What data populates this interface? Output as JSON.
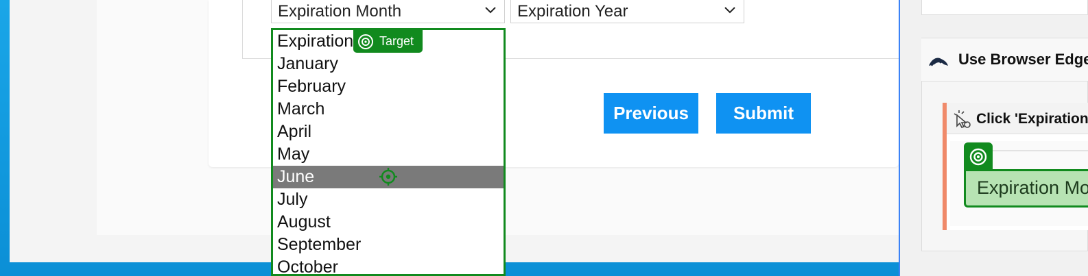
{
  "form": {
    "month_select_value": "Expiration Month",
    "year_select_value": "Expiration Year"
  },
  "buttons": {
    "previous": "Previous",
    "submit": "Submit"
  },
  "dropdown": {
    "options": [
      "Expiration Month",
      "January",
      "February",
      "March",
      "April",
      "May",
      "June",
      "July",
      "August",
      "September",
      "October"
    ],
    "highlighted": "June"
  },
  "target_badge": "Target",
  "panel": {
    "browser_title": "Use Browser Edge",
    "step_title": "Click 'Expiration Month'",
    "target_text": "Expiration Month"
  },
  "colors": {
    "accent_green": "#118a1e",
    "button_blue": "#0f92f2",
    "step_accent": "#f08a6a"
  }
}
